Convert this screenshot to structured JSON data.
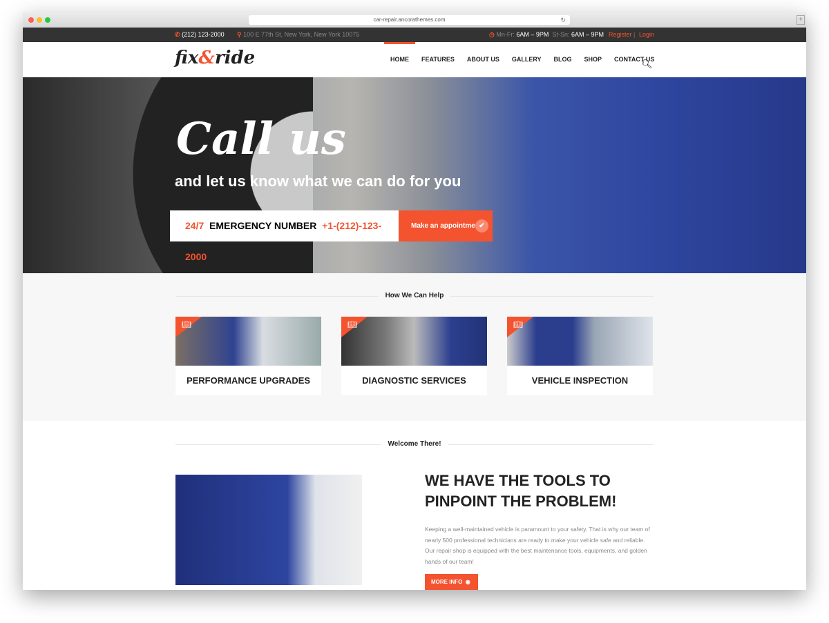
{
  "browser": {
    "url": "car-repair.ancorathemes.com"
  },
  "topbar": {
    "phone": "(212) 123-2000",
    "address": "100 E 77th St, New York, New York 10075",
    "hours_weekday_label": "Mn-Fr:",
    "hours_weekday": "6AM – 9PM",
    "hours_weekend_label": "St-Sn:",
    "hours_weekend": "6AM – 9PM",
    "register": "Register",
    "login": "Login"
  },
  "header": {
    "logo_a": "fix",
    "logo_amp": "&",
    "logo_b": "ride",
    "nav": [
      "HOME",
      "FEATURES",
      "ABOUT US",
      "GALLERY",
      "BLOG",
      "SHOP",
      "CONTACT US"
    ]
  },
  "hero": {
    "title": "Call us",
    "subtitle": "and let us know what we can do for you",
    "emergency_247": "24/7",
    "emergency_label": "EMERGENCY NUMBER",
    "emergency_phone": "+1-(212)-123-2000",
    "appointment": "Make an appointment"
  },
  "help": {
    "title": "How We Can Help",
    "cards": [
      "PERFORMANCE UPGRADES",
      "DIAGNOSTIC SERVICES",
      "VEHICLE INSPECTION"
    ]
  },
  "welcome": {
    "title": "Welcome There!",
    "heading": "WE HAVE THE TOOLS TO PINPOINT THE PROBLEM!",
    "body": "Keeping a well-maintained vehicle is paramount to your safety. That is why our team of nearly 500 professional technicians are ready to make your vehicle safe and reliable. Our repair shop is equipped with the best maintenance tools, equipments, and golden hands of our team!",
    "button": "MORE INFO"
  },
  "colors": {
    "accent": "#f4532f",
    "topbar": "#333333"
  }
}
